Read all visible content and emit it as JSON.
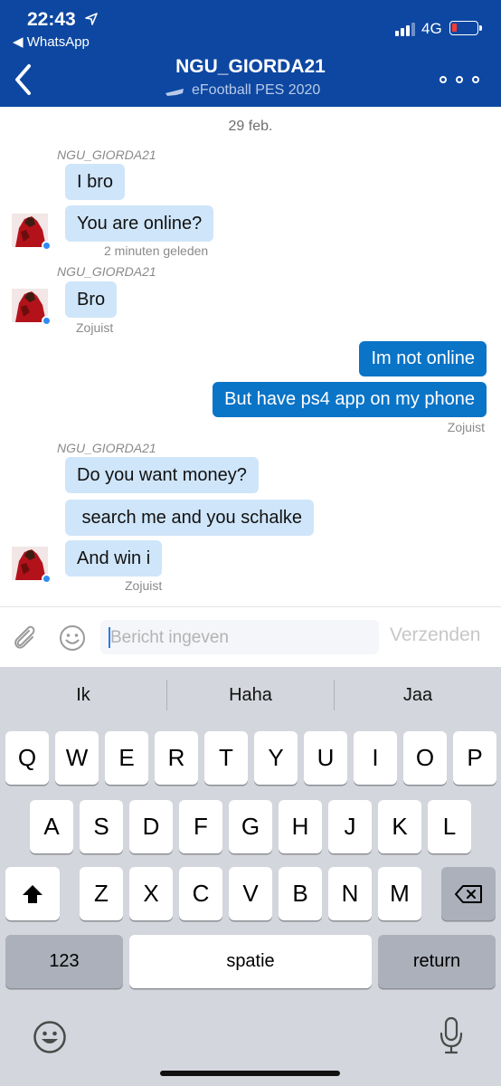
{
  "status": {
    "time": "22:43",
    "back_app": "◀ WhatsApp",
    "network": "4G"
  },
  "header": {
    "title": "NGU_GIORDA21",
    "subtitle": "eFootball PES 2020"
  },
  "chat": {
    "date": "29 feb.",
    "groups": [
      {
        "sender": "NGU_GIORDA21",
        "messages": [
          "I bro",
          "You are online?"
        ],
        "timestamp": "2 minuten geleden"
      },
      {
        "sender": "NGU_GIORDA21",
        "messages": [
          "Bro"
        ],
        "timestamp": "Zojuist"
      },
      {
        "outgoing": true,
        "messages": [
          "Im not online",
          "But have ps4 app on my phone"
        ],
        "timestamp": "Zojuist"
      },
      {
        "sender": "NGU_GIORDA21",
        "messages": [
          "Do you want money?",
          " search me and you schalke",
          "And win i"
        ],
        "timestamp": "Zojuist"
      }
    ]
  },
  "composer": {
    "placeholder": "Bericht ingeven",
    "send_label": "Verzenden"
  },
  "keyboard": {
    "suggestions": [
      "Ik",
      "Haha",
      "Jaa"
    ],
    "row1": [
      "Q",
      "W",
      "E",
      "R",
      "T",
      "Y",
      "U",
      "I",
      "O",
      "P"
    ],
    "row2": [
      "A",
      "S",
      "D",
      "F",
      "G",
      "H",
      "J",
      "K",
      "L"
    ],
    "row3": [
      "Z",
      "X",
      "C",
      "V",
      "B",
      "N",
      "M"
    ],
    "numbers_label": "123",
    "space_label": "spatie",
    "return_label": "return"
  },
  "colors": {
    "header_bg": "#0d47a1",
    "incoming_bubble": "#cfe5f9",
    "outgoing_bubble": "#0a74c7",
    "online_dot": "#2f8cf3"
  },
  "icons": [
    "location-arrow-icon",
    "signal-icon",
    "battery-icon",
    "back-chevron-icon",
    "controller-icon",
    "more-icon",
    "attach-icon",
    "emoji-icon",
    "shift-icon",
    "backspace-icon",
    "emoji-keyboard-icon",
    "microphone-icon"
  ]
}
